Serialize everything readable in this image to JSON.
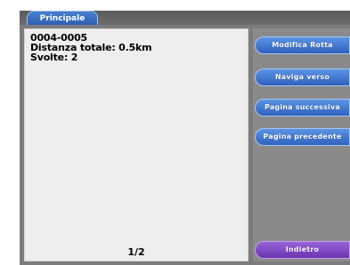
{
  "tab": {
    "label": "Principale"
  },
  "panel": {
    "route_name": "0004-0005",
    "distance": "Distanza totale: 0.5km",
    "turns": "Svolte: 2",
    "page_indicator": "1/2"
  },
  "buttons": {
    "edit_route": "Modifica Rotta",
    "navigate_to": "Naviga verso",
    "next_page": "Pagina successiva",
    "previous_page": "Pagina precedente",
    "back": "Indietro"
  },
  "colors": {
    "blue_button": "#2f62bd",
    "purple_button": "#6a34b0",
    "background": "#7c7c7c"
  }
}
